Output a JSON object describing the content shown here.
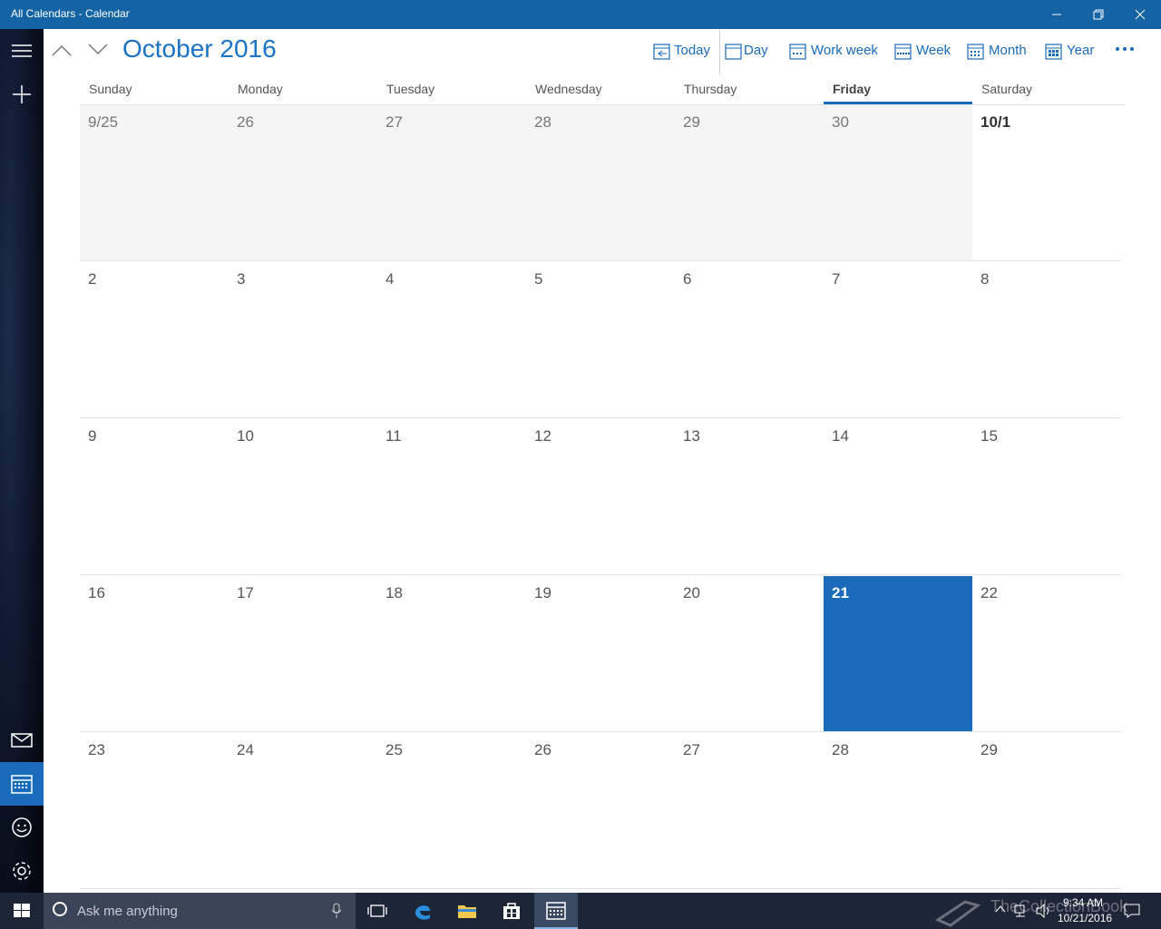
{
  "window": {
    "title": "All Calendars - Calendar",
    "accent": "#1463a5"
  },
  "rail": {
    "items": [
      {
        "name": "hamburger-menu-icon"
      },
      {
        "name": "new-event-icon"
      },
      {
        "name": "mail-icon"
      },
      {
        "name": "calendar-icon",
        "active": true
      },
      {
        "name": "people-icon"
      },
      {
        "name": "settings-icon"
      }
    ]
  },
  "header": {
    "month_title": "October 2016",
    "views": {
      "today": "Today",
      "day": "Day",
      "work_week": "Work week",
      "week": "Week",
      "month": "Month",
      "year": "Year"
    }
  },
  "calendar": {
    "day_names": [
      "Sunday",
      "Monday",
      "Tuesday",
      "Wednesday",
      "Thursday",
      "Friday",
      "Saturday"
    ],
    "today_column": 5,
    "weeks": [
      [
        "9/25",
        "26",
        "27",
        "28",
        "29",
        "30",
        "10/1"
      ],
      [
        "2",
        "3",
        "4",
        "5",
        "6",
        "7",
        "8"
      ],
      [
        "9",
        "10",
        "11",
        "12",
        "13",
        "14",
        "15"
      ],
      [
        "16",
        "17",
        "18",
        "19",
        "20",
        "21",
        "22"
      ],
      [
        "23",
        "24",
        "25",
        "26",
        "27",
        "28",
        "29"
      ]
    ],
    "today_label": "21",
    "today_color": "#1a6bba"
  },
  "taskbar": {
    "search_placeholder": "Ask me anything",
    "time": "9:34 AM",
    "date": "10/21/2016",
    "watermark": "TheCollectionBook"
  }
}
